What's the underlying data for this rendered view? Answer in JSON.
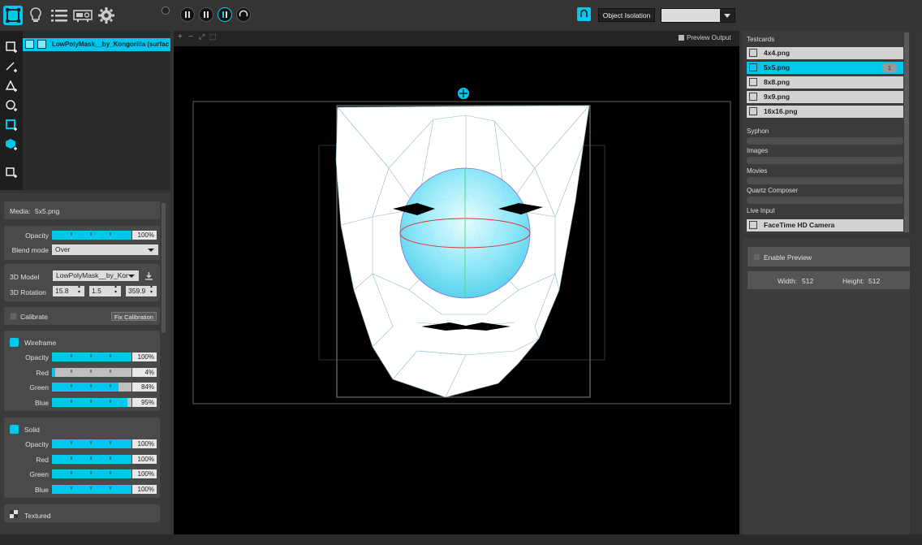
{
  "toolbar": {
    "icons": [
      "surface-icon",
      "lightbulb-icon",
      "list-icon",
      "projector-icon",
      "gear-icon"
    ],
    "transport": [
      "pause-icon",
      "pause-icon",
      "pause-active-icon",
      "refresh-icon"
    ],
    "object_isolation_label": "Object Isolation",
    "object_isolation_value": ""
  },
  "layers": {
    "tools": [
      "add-quad-icon",
      "add-line-icon",
      "add-triangle-icon",
      "add-circle-icon",
      "add-crop-icon",
      "add-3d-icon",
      "add-layer-icon"
    ],
    "items": [
      {
        "name": "LowPolyMask__by_Kongorilla (surfac"
      }
    ]
  },
  "properties": {
    "media_label": "Media:",
    "media_value": "5x5.png",
    "opacity_label": "Opacity",
    "opacity_value": "100%",
    "opacity_level": 1.0,
    "blend_label": "Blend mode",
    "blend_value": "Over",
    "model_label": "3D Model",
    "model_value": "LowPolyMask__by_Kor",
    "rotation_label": "3D Rotation",
    "rotation": [
      "15.8",
      "1.5",
      "359.9"
    ],
    "calibrate_label": "Calibrate",
    "fix_calibration_label": "Fix Calibration",
    "wireframe": {
      "title": "Wireframe",
      "rows": [
        {
          "label": "Opacity",
          "value": "100%",
          "level": 1.0
        },
        {
          "label": "Red",
          "value": "4%",
          "level": 0.04
        },
        {
          "label": "Green",
          "value": "84%",
          "level": 0.84
        },
        {
          "label": "Blue",
          "value": "95%",
          "level": 0.95
        }
      ]
    },
    "solid": {
      "title": "Solid",
      "rows": [
        {
          "label": "Opacity",
          "value": "100%",
          "level": 1.0
        },
        {
          "label": "Red",
          "value": "100%",
          "level": 1.0
        },
        {
          "label": "Green",
          "value": "100%",
          "level": 1.0
        },
        {
          "label": "Blue",
          "value": "100%",
          "level": 1.0
        }
      ]
    },
    "textured_label": "Textured"
  },
  "viewport": {
    "toolbar_icons": [
      "+",
      "−",
      "⤢",
      "⬚"
    ],
    "preview_output_label": "Preview Output"
  },
  "media_panel": {
    "testcards_label": "Testcards",
    "testcards": [
      {
        "name": "4x4.png",
        "selected": false
      },
      {
        "name": "5x5.png",
        "selected": true,
        "badge": "1"
      },
      {
        "name": "8x8.png",
        "selected": false
      },
      {
        "name": "9x9.png",
        "selected": false
      },
      {
        "name": "16x16.png",
        "selected": false
      }
    ],
    "syphon_label": "Syphon",
    "images_label": "Images",
    "movies_label": "Movies",
    "quartz_label": "Quartz Composer",
    "live_input_label": "Live Input",
    "live_inputs": [
      {
        "name": "FaceTime HD Camera"
      }
    ]
  },
  "preview_panel": {
    "enable_label": "Enable Preview",
    "width_label": "Width:",
    "width_value": "512",
    "height_label": "Height:",
    "height_value": "512"
  },
  "colors": {
    "accent": "#00c8ec",
    "panel": "#4a4a4a",
    "background": "#353535"
  }
}
